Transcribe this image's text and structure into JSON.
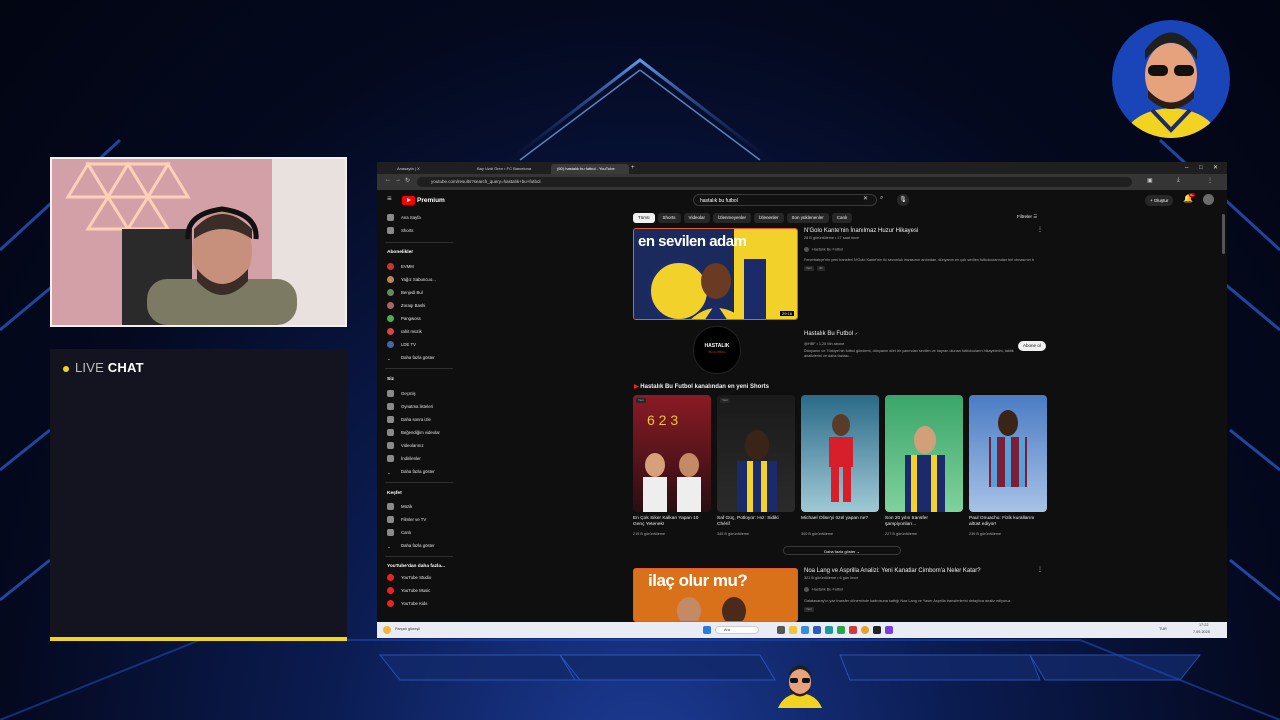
{
  "overlay": {
    "chat_title_prefix": "LIVE",
    "chat_title_suffix": "CHAT",
    "accent": "#f2d51d"
  },
  "browser": {
    "tabs": [
      "Anasayfa | X",
      "Bay Uzdi Ören • FC Barcelona",
      "(60) hastalık bu futbol - YouTube"
    ],
    "url": "youtube.com/results?search_query=hastalık+bu+futbol"
  },
  "youtube": {
    "logo": "Premium",
    "search_value": "hastalık bu futbol",
    "create_label": "Oluştur",
    "notification_count": "9+",
    "sidebar": {
      "top_items": [
        "Ana Sayfa",
        "Shorts"
      ],
      "subs_head": "Abonelikler",
      "subs": [
        "EVMM",
        "Yağız Sabuncuo...",
        "Benjedi Bul",
        "Zoraqı Bashi",
        "Pangwoss",
        "rahit müzik",
        "LDE TV",
        "Daha fazla göster"
      ],
      "you_head": "Siz",
      "you_items": [
        "Geçmiş",
        "Oynatma listeleri",
        "Daha sonra izle",
        "Beğendiğim videolar",
        "Videolarınız",
        "İndirilenler",
        "Daha fazla göster"
      ],
      "explore_head": "Keşfet",
      "explore_items": [
        "Müzik",
        "Filmler ve TV",
        "Canlı",
        "Daha fazla göster"
      ],
      "more_head": "YouTube'dan daha fazla...",
      "more_items": [
        "YouTube Studio",
        "YouTube Music",
        "YouTube Kids"
      ]
    },
    "chips": [
      "Tümü",
      "Shorts",
      "Videolar",
      "İzlenmeyenler",
      "İzlenenler",
      "Son yüklenenler",
      "Canlı"
    ],
    "filters_label": "Filtreler",
    "video1": {
      "thumb_text": "en sevilen adam",
      "title": "N'Golo Kante'nin İnanılmaz Huzur Hikayesi",
      "meta": "28 B görüntüleme • 17 saat önce",
      "channel": "Hastalık Bu Futbol",
      "desc": "Fenerbahçe'nin yeni transferi N'Golo Kanté'nin iki sezonluk imzasının ardından, dünyanın en çok sevilen futbolcularından biri olmasının hikayesi.",
      "duration": "29:16",
      "tag1": "Yeni",
      "tag2": "4K"
    },
    "channel": {
      "logo_top": "HASTALIK",
      "logo_bottom": "BU FUTBOL",
      "name": "Hastalık Bu Futbol",
      "handle": "@HBF • 1,25 Mn abone",
      "desc": "Dünyanın ve Türkiye'nin futbol gündemi, dünyanın dört bir yanından sevilen ve hayran olunan futbolcuların hikayelerini, taktik analizlerini ve daha fazlası...",
      "subscribe": "Abone ol"
    },
    "shorts_heading": "Hastalık Bu Futbol kanalından en yeni Shorts",
    "shorts": [
      {
        "title": "En Çok Siker Kalkan Yapan 10 Genç Yetenek!",
        "views": "215 B görüntüleme"
      },
      {
        "title": "Saf Güç, Potloyor: Hız: Sidiki Chérif",
        "views": "345 B görüntüleme"
      },
      {
        "title": "Michael Olise'yi özel yapan ne?",
        "views": "300 B görüntüleme"
      },
      {
        "title": "Son 20 yılın transfer şampiyonları...",
        "views": "227 B görüntüleme"
      },
      {
        "title": "Paul Onuachu: Fizik kurallarını altüst ediyor!",
        "views": "236 B görüntüleme"
      }
    ],
    "shorts_badge": "Yeni",
    "more_button": "Daha fazla göster",
    "video2": {
      "thumb_text": "ilaç olur mu?",
      "title": "Noa Lang ve Asprilla Analizi: Yeni Kanatlar Cimbom'a Neler Katar?",
      "meta": "321 B görüntüleme • 6 gün önce",
      "channel": "Hastalık Bu Futbol",
      "desc": "Galatasaray'ın yaz transfer döneminde kadrosuna kattığı Noa Lang ve Yaser Asprilla transferlerini detaylıca analiz ediyoruz.",
      "tag": "Yeni"
    }
  },
  "taskbar": {
    "weather": "Parçalı güneşli",
    "search": "Ara",
    "lang": "TUR",
    "time": "17:22",
    "date": "7.09.2025"
  }
}
